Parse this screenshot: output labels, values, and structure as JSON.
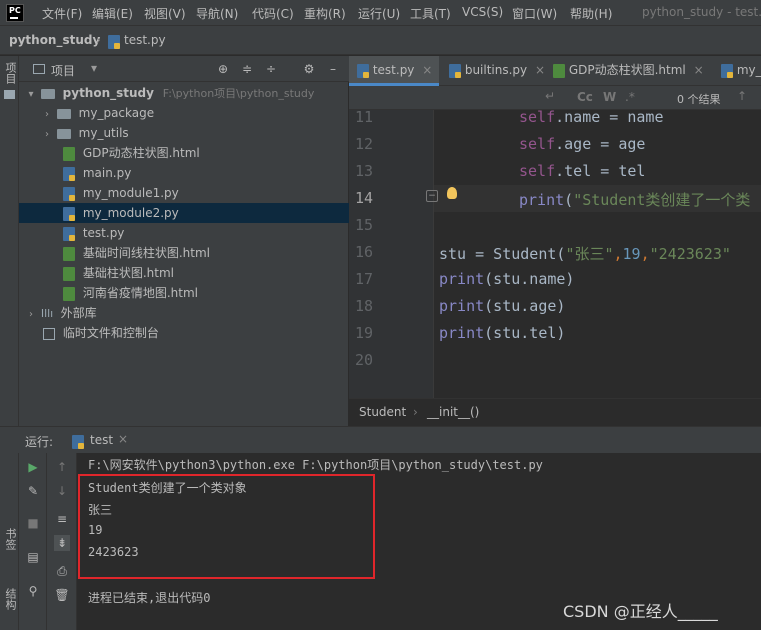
{
  "menubar": {
    "logo": "PC",
    "items": [
      "文件(F)",
      "编辑(E)",
      "视图(V)",
      "导航(N)",
      "代码(C)",
      "重构(R)",
      "运行(U)",
      "工具(T)",
      "VCS(S)",
      "窗口(W)",
      "帮助(H)"
    ],
    "window_title": "python_study - test.py"
  },
  "navbar": {
    "project": "python_study",
    "file": "test.py"
  },
  "left_strip": {
    "project_label": "项目",
    "bookmarks_label": "书签",
    "structure_label": "结构"
  },
  "project_panel": {
    "title": "项目",
    "root_name": "python_study",
    "root_path": "F:\\python项目\\python_study",
    "items": [
      {
        "label": "my_package",
        "type": "folder"
      },
      {
        "label": "my_utils",
        "type": "folder"
      },
      {
        "label": "GDP动态柱状图.html",
        "type": "html"
      },
      {
        "label": "main.py",
        "type": "py"
      },
      {
        "label": "my_module1.py",
        "type": "py"
      },
      {
        "label": "my_module2.py",
        "type": "py"
      },
      {
        "label": "test.py",
        "type": "py"
      },
      {
        "label": "基础时间线柱状图.html",
        "type": "html"
      },
      {
        "label": "基础柱状图.html",
        "type": "html"
      },
      {
        "label": "河南省疫情地图.html",
        "type": "html"
      }
    ],
    "external_libs": "外部库",
    "scratches": "临时文件和控制台"
  },
  "editor": {
    "tabs": [
      "test.py",
      "builtins.py",
      "GDP动态柱状图.html",
      "my_m"
    ],
    "search_results": "0 个结果",
    "search_opts": [
      "Cc",
      "W"
    ],
    "line_numbers": [
      "11",
      "12",
      "13",
      "14",
      "15",
      "16",
      "17",
      "18",
      "19",
      "20"
    ],
    "lines": {
      "l11": {
        "self": "self",
        "rest": ".name = name"
      },
      "l12": {
        "self": "self",
        "rest": ".age = age"
      },
      "l13": {
        "self": "self",
        "rest": ".tel = tel"
      },
      "l14": {
        "fn": "print",
        "open": "(",
        "str": "\"Student类创建了一个类"
      },
      "l16": {
        "a": "stu = Student(",
        "s1": "\"张三\"",
        "c1": ",",
        "n": "19",
        "c2": ",",
        "s2": "\"2423623\""
      },
      "l17": {
        "fn": "print",
        "rest": "(stu.name)"
      },
      "l18": {
        "fn": "print",
        "rest": "(stu.age)"
      },
      "l19": {
        "fn": "print",
        "rest": "(stu.tel)"
      }
    },
    "breadcrumb": [
      "Student",
      "__init__()"
    ]
  },
  "run_panel": {
    "label": "运行:",
    "tab": "test",
    "console": {
      "command": "F:\\网安软件\\python3\\python.exe F:\\python项目\\python_study\\test.py",
      "output": [
        "Student类创建了一个类对象",
        "张三",
        "19",
        "2423623"
      ],
      "exit": "进程已结束,退出代码0"
    }
  },
  "watermark": "CSDN @正经人_____",
  "colors": {
    "accent": "#4a88c7",
    "highlight_box": "#e0262b",
    "selection": "#0d293e"
  }
}
